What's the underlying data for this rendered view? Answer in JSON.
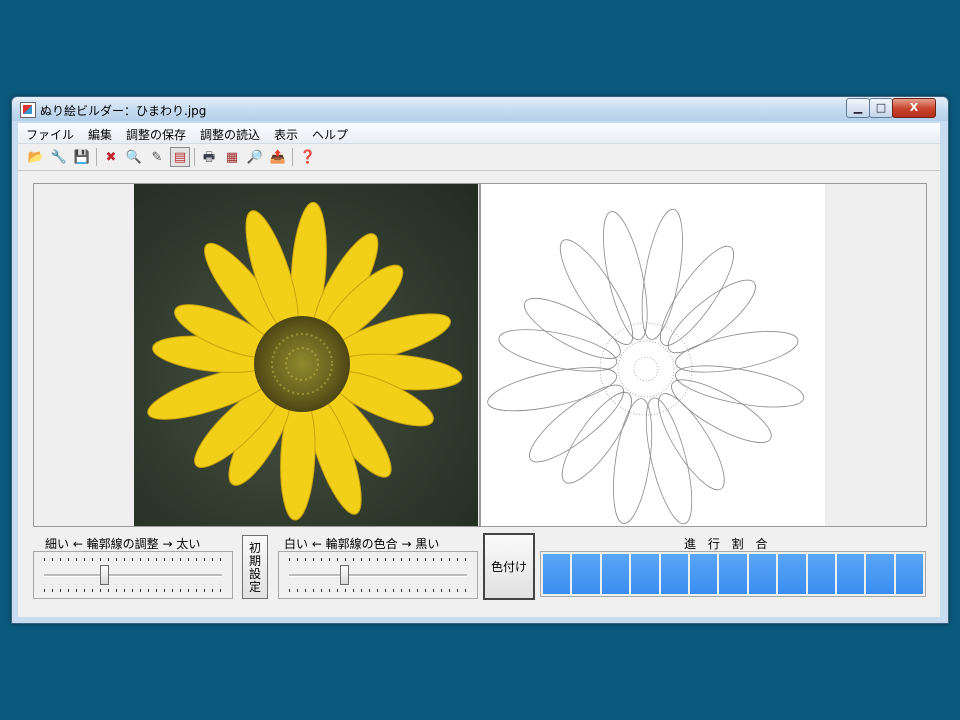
{
  "window": {
    "title": "ぬり絵ビルダー：ひまわり.jpg",
    "minimize_glyph": "▁",
    "maximize_glyph": "□",
    "close_glyph": "X"
  },
  "menu": [
    "ファイル",
    "編集",
    "調整の保存",
    "調整の読込",
    "表示",
    "ヘルプ"
  ],
  "toolbar": [
    {
      "icon": "open-folder-icon",
      "glyph": "📂",
      "pressed": false
    },
    {
      "icon": "settings-tools-icon",
      "glyph": "🔧",
      "pressed": false
    },
    {
      "icon": "save-disk-icon",
      "glyph": "💾",
      "pressed": false
    },
    {
      "icon": "close-document-icon",
      "glyph": "✖",
      "pressed": false
    },
    {
      "icon": "zoom-magnifier-icon",
      "glyph": "🔍",
      "pressed": false
    },
    {
      "icon": "edit-pen-icon",
      "glyph": "✎",
      "pressed": false
    },
    {
      "icon": "compare-view-icon",
      "glyph": "▤",
      "pressed": true
    },
    {
      "icon": "print-icon",
      "glyph": "🖶",
      "pressed": false
    },
    {
      "icon": "print-setup-icon",
      "glyph": "▦",
      "pressed": false
    },
    {
      "icon": "print-preview-icon",
      "glyph": "🔎",
      "pressed": false
    },
    {
      "icon": "export-icon",
      "glyph": "📤",
      "pressed": false
    },
    {
      "icon": "help-icon",
      "glyph": "❓",
      "pressed": false
    }
  ],
  "controls": {
    "outline_width": {
      "label": "細い ← 輪郭線の調整 → 太い",
      "level": 0.33
    },
    "reset_button": "初\n期\n設\n定",
    "outline_color": {
      "label": "白い ← 輪郭線の色合 → 黒い",
      "level": 0.3
    },
    "colorize_button": "色付け",
    "progress": {
      "label": "進 行 割 合",
      "segments": 13,
      "filled": 13
    }
  },
  "colors": {
    "desktop": "#0b5a7e",
    "progress_fill": "#3b8ef0",
    "petal": "#f2cf19",
    "flower_center": "#6b6520"
  }
}
